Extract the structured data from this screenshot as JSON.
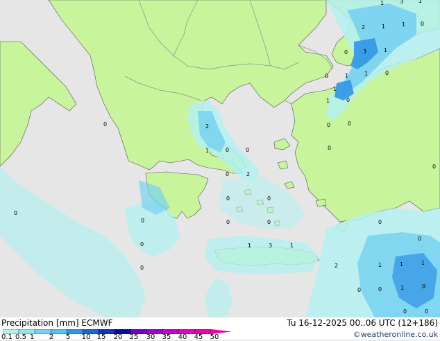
{
  "header": {
    "title": "Precipitation [mm]",
    "model": "ECMWF",
    "timestamp": "Tu 16-12-2025 00..06 UTC (12+186)",
    "credit": "©weatheronline.co.uk"
  },
  "legend": {
    "ticks": [
      "0.1",
      "0.5",
      "1",
      "2",
      "5",
      "10",
      "15",
      "20",
      "25",
      "30",
      "35",
      "40",
      "45",
      "50"
    ],
    "colors": [
      "#b4f0f0",
      "#96e6f0",
      "#78d2f0",
      "#50c3f0",
      "#3296e6",
      "#1e64d2",
      "#1432b4",
      "#0a0a96",
      "#6e00c8",
      "#a000c8",
      "#c800c8",
      "#e600c8",
      "#f000a0"
    ]
  },
  "colors": {
    "sea": "#e6e6e6",
    "land": "#c8f59b",
    "precip_light": "#b4f0f0",
    "precip_mid": "#78d2f0",
    "precip_heavy": "#3296e6",
    "border": "#8c8c8c",
    "coast": "#505050"
  },
  "map_labels": {
    "items": [
      "1",
      "3",
      "1",
      "2",
      "1",
      "1",
      "0",
      "0",
      "3",
      "1",
      "0",
      "1",
      "1",
      "0",
      "1",
      "1",
      "0",
      "0",
      "0",
      "0",
      "2",
      "1",
      "0",
      "0",
      "0",
      "2",
      "0",
      "0",
      "0",
      "0",
      "0",
      "0",
      "0",
      "0",
      "0",
      "0",
      "0",
      "1",
      "3",
      "1",
      "2",
      "1",
      "1",
      "1",
      "0",
      "0",
      "0",
      "1",
      "0",
      "0",
      "0"
    ]
  }
}
